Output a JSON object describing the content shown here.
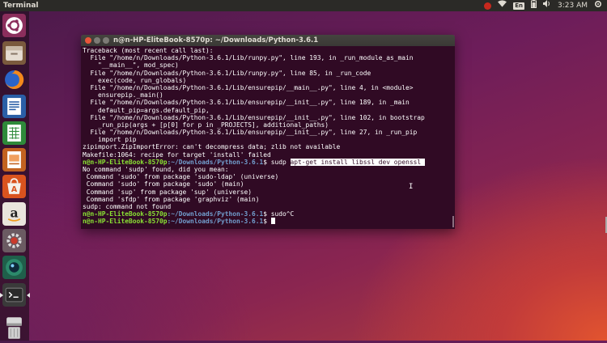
{
  "panel": {
    "app_title": "Terminal",
    "lang": "En",
    "time": "3:23 AM"
  },
  "launcher": {
    "items": [
      {
        "name": "ubuntu-dash-icon"
      },
      {
        "name": "files-icon"
      },
      {
        "name": "firefox-icon"
      },
      {
        "name": "libreoffice-writer-icon"
      },
      {
        "name": "libreoffice-calc-icon"
      },
      {
        "name": "libreoffice-impress-icon"
      },
      {
        "name": "software-center-icon"
      },
      {
        "name": "amazon-icon"
      },
      {
        "name": "system-settings-icon"
      },
      {
        "name": "browser-globe-icon"
      },
      {
        "name": "terminal-icon"
      },
      {
        "name": "drive-icon"
      },
      {
        "name": "trash-icon"
      }
    ]
  },
  "terminal": {
    "title": "n@n-HP-EliteBook-8570p: ~/Downloads/Python-3.6.1",
    "prompt_user": "n@n-HP-EliteBook-8570p",
    "prompt_path": ":~/Downloads/Python-3.6.1",
    "lines": [
      "Traceback (most recent call last):",
      "  File \"/home/n/Downloads/Python-3.6.1/Lib/runpy.py\", line 193, in _run_module_as_main",
      "    \"__main__\", mod_spec)",
      "  File \"/home/n/Downloads/Python-3.6.1/Lib/runpy.py\", line 85, in _run_code",
      "    exec(code, run_globals)",
      "  File \"/home/n/Downloads/Python-3.6.1/Lib/ensurepip/__main__.py\", line 4, in <module>",
      "    ensurepip._main()",
      "  File \"/home/n/Downloads/Python-3.6.1/Lib/ensurepip/__init__.py\", line 189, in _main",
      "    default_pip=args.default_pip,",
      "  File \"/home/n/Downloads/Python-3.6.1/Lib/ensurepip/__init__.py\", line 102, in bootstrap",
      "    _run_pip(args + [p[0] for p in _PROJECTS], additional_paths)",
      "  File \"/home/n/Downloads/Python-3.6.1/Lib/ensurepip/__init__.py\", line 27, in _run_pip",
      "    import pip",
      "zipimport.ZipImportError: can't decompress data; zlib not available",
      "Makefile:1064: recipe for target 'install' failed"
    ],
    "cmd1": "$ sudp ",
    "cmd1_selected": "apt-get install libssl dev openssl ",
    "lines2": [
      "No command 'sudp' found, did you mean:",
      " Command 'sudo' from package 'sudo-ldap' (universe)",
      " Command 'sudo' from package 'sudo' (main)",
      " Command 'sup' from package 'sup' (universe)",
      " Command 'sfdp' from package 'graphviz' (main)",
      "sudp: command not found"
    ],
    "cmd2": "$ sudo^C",
    "cmd3": "$ "
  }
}
